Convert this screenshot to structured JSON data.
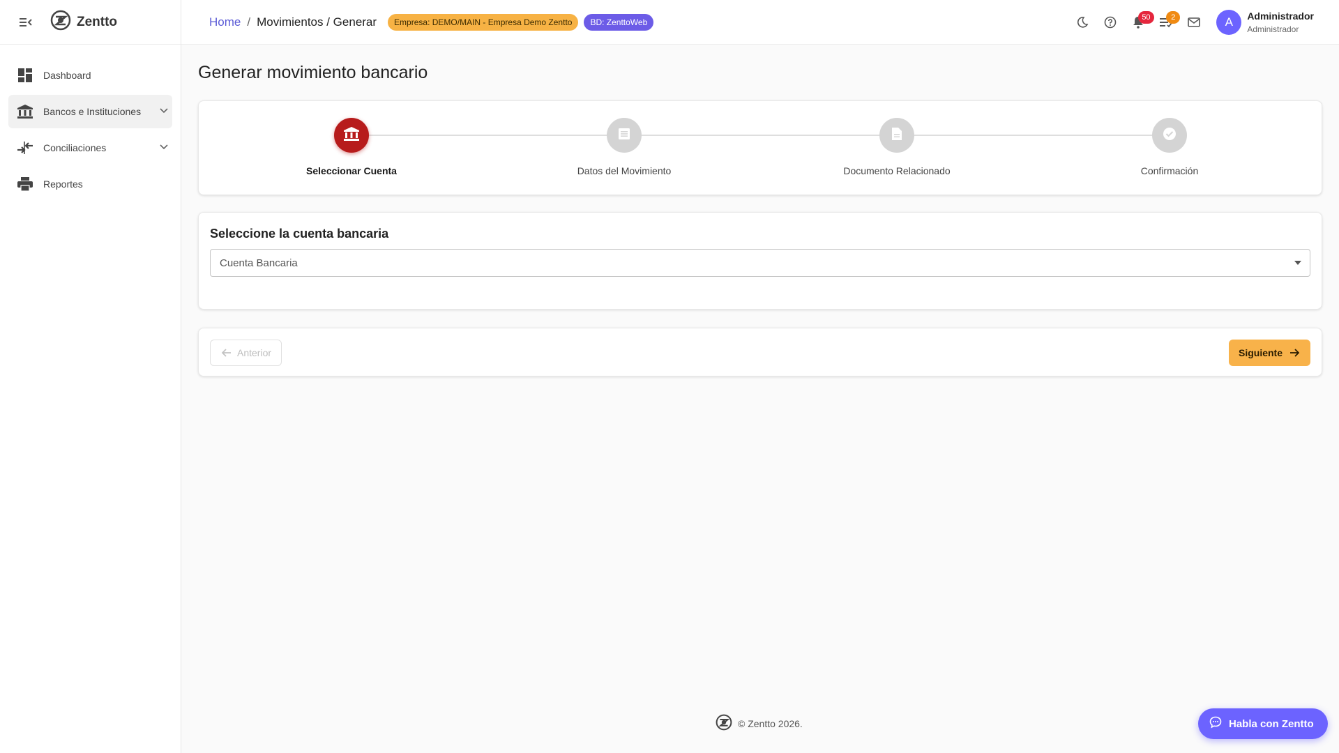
{
  "app": {
    "brand_name": "Zentto",
    "accent_color": "#6c63ff",
    "primary_step_color": "#b71c1c"
  },
  "sidebar": {
    "items": [
      {
        "label": "Dashboard",
        "icon": "dashboard-icon"
      },
      {
        "label": "Bancos e Instituciones",
        "icon": "bank-icon",
        "active": true,
        "expandable": true
      },
      {
        "label": "Conciliaciones",
        "icon": "compare-arrows-icon",
        "expandable": true
      },
      {
        "label": "Reportes",
        "icon": "print-icon"
      }
    ]
  },
  "header": {
    "breadcrumb_home": "Home",
    "breadcrumb_separator": "/",
    "breadcrumb_current": "Movimientos / Generar",
    "company_chip": "Empresa: DEMO/MAIN - Empresa Demo Zentto",
    "db_chip": "BD: ZenttoWeb",
    "notifications_count": "50",
    "tasks_count": "2",
    "avatar_letter": "A",
    "user_name": "Administrador",
    "user_role": "Administrador"
  },
  "main": {
    "page_title": "Generar movimiento bancario",
    "steps": [
      {
        "label": "Seleccionar Cuenta",
        "icon": "bank-icon",
        "active": true
      },
      {
        "label": "Datos del Movimiento",
        "icon": "list-icon",
        "active": false
      },
      {
        "label": "Documento Relacionado",
        "icon": "document-icon",
        "active": false
      },
      {
        "label": "Confirmación",
        "icon": "check-circle-icon",
        "active": false
      }
    ],
    "section_title": "Seleccione la cuenta bancaria",
    "select_label": "Cuenta Bancaria",
    "prev_button": "Anterior",
    "next_button": "Siguiente"
  },
  "footer": {
    "copyright": "© Zentto 2026."
  },
  "chat": {
    "label": "Habla con Zentto"
  }
}
